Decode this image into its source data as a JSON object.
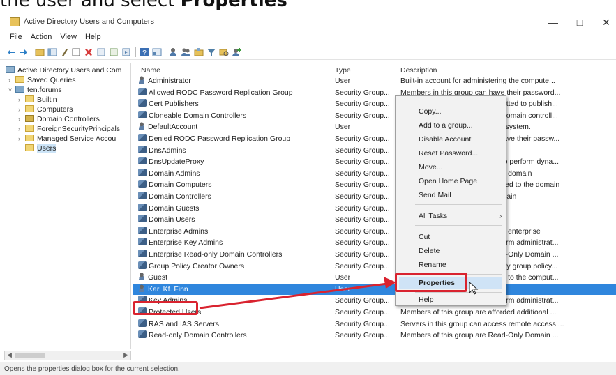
{
  "caption": {
    "prefix": "the user and select ",
    "bold": "Properties"
  },
  "window": {
    "title": "Active Directory Users and Computers",
    "minimize": "—",
    "maximize": "□",
    "close": "✕"
  },
  "menu": [
    "File",
    "Action",
    "View",
    "Help"
  ],
  "tree": [
    {
      "label": "Active Directory Users and Com",
      "icon": "root-icon",
      "twisty": ""
    },
    {
      "label": "Saved Queries",
      "icon": "folder-icon",
      "twisty": "›"
    },
    {
      "label": "ten.forums",
      "icon": "domain-icon",
      "twisty": "˅"
    },
    {
      "label": "Builtin",
      "icon": "folder-icon",
      "twisty": "›"
    },
    {
      "label": "Computers",
      "icon": "folder-icon",
      "twisty": "›"
    },
    {
      "label": "Domain Controllers",
      "icon": "ou-icon",
      "twisty": "›"
    },
    {
      "label": "ForeignSecurityPrincipals",
      "icon": "folder-icon",
      "twisty": "›"
    },
    {
      "label": "Managed Service Accou",
      "icon": "folder-icon",
      "twisty": "›"
    },
    {
      "label": "Users",
      "icon": "folder-icon",
      "twisty": ""
    }
  ],
  "columns": {
    "name": "Name",
    "type": "Type",
    "description": "Description"
  },
  "rows": [
    {
      "name": "Administrator",
      "type": "User",
      "desc": "Built-in account for administering the compute...",
      "kind": "user"
    },
    {
      "name": "Allowed RODC Password Replication Group",
      "type": "Security Group...",
      "desc": "Members in this group can have their password...",
      "kind": "group"
    },
    {
      "name": "Cert Publishers",
      "type": "Security Group...",
      "desc": "Members of this group are permitted to publish...",
      "kind": "group"
    },
    {
      "name": "Cloneable Domain Controllers",
      "type": "Security Group...",
      "desc": "Members of this group that are domain controll...",
      "kind": "group"
    },
    {
      "name": "DefaultAccount",
      "type": "User",
      "desc": "A user account managed by the system.",
      "kind": "user"
    },
    {
      "name": "Denied RODC Password Replication Group",
      "type": "Security Group...",
      "desc": "Members in this group cannot have their passw...",
      "kind": "group"
    },
    {
      "name": "DnsAdmins",
      "type": "Security Group...",
      "desc": "DNS Administrators Group",
      "kind": "group"
    },
    {
      "name": "DnsUpdateProxy",
      "type": "Security Group...",
      "desc": "DNS clients who are permitted to perform dyna...",
      "kind": "group"
    },
    {
      "name": "Domain Admins",
      "type": "Security Group...",
      "desc": "Designated administrators of the domain",
      "kind": "group"
    },
    {
      "name": "Domain Computers",
      "type": "Security Group...",
      "desc": "All workstations and servers joined to the domain",
      "kind": "group"
    },
    {
      "name": "Domain Controllers",
      "type": "Security Group...",
      "desc": "All domain controllers in the domain",
      "kind": "group"
    },
    {
      "name": "Domain Guests",
      "type": "Security Group...",
      "desc": "All domain guests",
      "kind": "group"
    },
    {
      "name": "Domain Users",
      "type": "Security Group...",
      "desc": "All domain users",
      "kind": "group"
    },
    {
      "name": "Enterprise Admins",
      "type": "Security Group...",
      "desc": "Designated administrators of the enterprise",
      "kind": "group"
    },
    {
      "name": "Enterprise Key Admins",
      "type": "Security Group...",
      "desc": "Members of this group can perform administrat...",
      "kind": "group"
    },
    {
      "name": "Enterprise Read-only Domain Controllers",
      "type": "Security Group...",
      "desc": "Members of this group are Read-Only Domain ...",
      "kind": "group"
    },
    {
      "name": "Group Policy Creator Owners",
      "type": "Security Group...",
      "desc": "Members in this group can modify group policy...",
      "kind": "group"
    },
    {
      "name": "Guest",
      "type": "User",
      "desc": "Built-in account for guest access to the comput...",
      "kind": "user"
    },
    {
      "name": "Kari Kf. Finn",
      "type": "User",
      "desc": "",
      "kind": "user",
      "selected": true
    },
    {
      "name": "Key Admins",
      "type": "Security Group...",
      "desc": "Members of this group can perform administrat...",
      "kind": "group"
    },
    {
      "name": "Protected Users",
      "type": "Security Group...",
      "desc": "Members of this group are afforded additional ...",
      "kind": "group"
    },
    {
      "name": "RAS and IAS Servers",
      "type": "Security Group...",
      "desc": "Servers in this group can access remote access ...",
      "kind": "group"
    },
    {
      "name": "Read-only Domain Controllers",
      "type": "Security Group...",
      "desc": "Members of this group are Read-Only Domain ...",
      "kind": "group"
    }
  ],
  "context_menu": {
    "copy": "Copy...",
    "add_group": "Add to a group...",
    "disable": "Disable Account",
    "reset": "Reset Password...",
    "move": "Move...",
    "home": "Open Home Page",
    "mail": "Send Mail",
    "all_tasks": "All Tasks",
    "cut": "Cut",
    "delete": "Delete",
    "rename": "Rename",
    "properties": "Properties",
    "help": "Help"
  },
  "status": "Opens the properties dialog box for the current selection.",
  "colors": {
    "highlight": "#cfe3f6",
    "selected_row": "#2f86dd",
    "annotation": "#d9232f"
  }
}
